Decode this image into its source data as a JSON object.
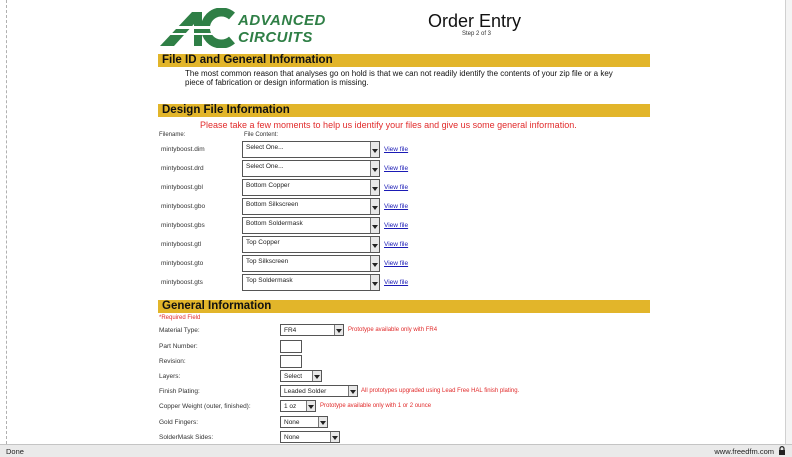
{
  "header": {
    "logo_line1": "ADVANCED",
    "logo_line2": "CIRCUITS",
    "title": "Order Entry",
    "step": "Step 2 of 3"
  },
  "sections": {
    "file_id": {
      "title": "File ID and General Information",
      "text": "The most common reason that analyses go on hold is that we can not readily identify the contents of your zip file or a key piece of fabrication or design information is missing."
    },
    "design": {
      "title": "Design File Information",
      "note": "Please take a few moments to help us identify your files and give us some general information.",
      "col_filename": "Filename:",
      "col_content": "File Content:",
      "view_label": "View file",
      "files": [
        {
          "name": "mintyboost.dim",
          "content": "Select One..."
        },
        {
          "name": "mintyboost.drd",
          "content": "Select One..."
        },
        {
          "name": "mintyboost.gbl",
          "content": "Bottom Copper"
        },
        {
          "name": "mintyboost.gbo",
          "content": "Bottom Silkscreen"
        },
        {
          "name": "mintyboost.gbs",
          "content": "Bottom Soldermask"
        },
        {
          "name": "mintyboost.gtl",
          "content": "Top Copper"
        },
        {
          "name": "mintyboost.gto",
          "content": "Top Silkscreen"
        },
        {
          "name": "mintyboost.gts",
          "content": "Top Soldermask"
        }
      ]
    },
    "general": {
      "title": "General Information",
      "required": "*Required Field",
      "fields": {
        "material": {
          "label": "Material Type:",
          "value": "FR4",
          "note": "Prototype available only with FR4"
        },
        "part_number": {
          "label": "Part Number:"
        },
        "revision": {
          "label": "Revision:"
        },
        "layers": {
          "label": "Layers:",
          "value": "Select"
        },
        "finish": {
          "label": "Finish Plating:",
          "value": "Leaded Solder",
          "note": "All prototypes upgraded using Lead Free HAL finish plating."
        },
        "copper": {
          "label": "Copper Weight (outer, finished):",
          "value": "1 oz",
          "note": "Prototype available only with 1 or 2 ounce"
        },
        "gold": {
          "label": "Gold Fingers:",
          "value": "None"
        },
        "soldermask_sides": {
          "label": "SolderMask Sides:",
          "value": "None"
        }
      }
    }
  },
  "status": {
    "left": "Done",
    "right": "www.freedfm.com"
  },
  "colors": {
    "band": "#e2b52a",
    "logo_green": "#2f7f46",
    "note_red": "#e12b2b",
    "link_blue": "#1a1ab5"
  }
}
